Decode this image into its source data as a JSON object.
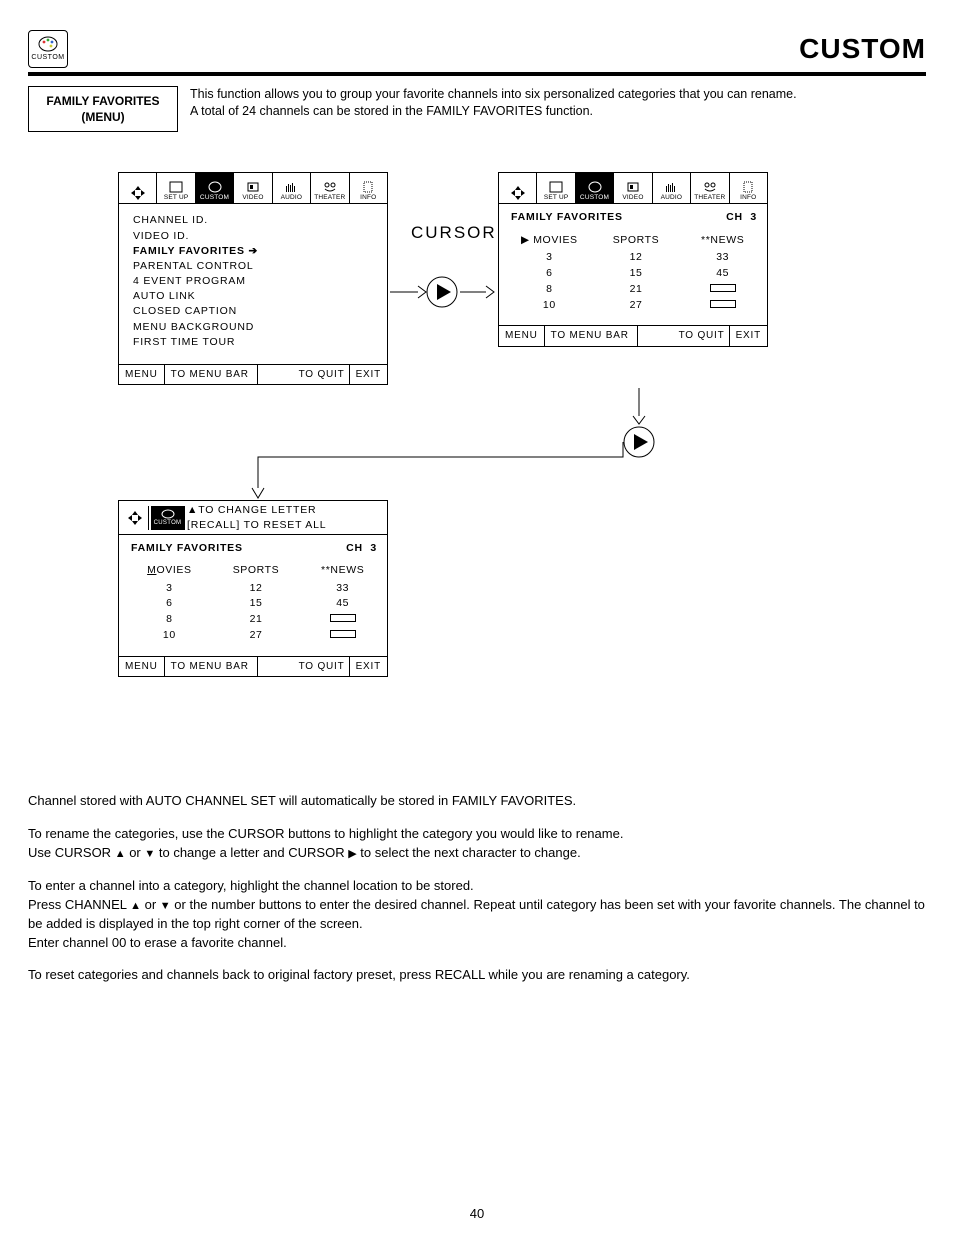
{
  "header": {
    "badge_label": "CUSTOM",
    "title": "CUSTOM"
  },
  "section": {
    "label_line1": "FAMILY FAVORITES",
    "label_line2": "(MENU)",
    "intro_line1": "This function allows you to group your favorite channels into six personalized categories that you can rename.",
    "intro_line2": "A total of 24 channels can be stored in the FAMILY FAVORITES function."
  },
  "iconbar": {
    "arrows": "",
    "items": [
      "SET UP",
      "CUSTOM",
      "VIDEO",
      "AUDIO",
      "THEATER",
      "INFO"
    ]
  },
  "menu_left": {
    "items": [
      "CHANNEL ID.",
      "VIDEO ID.",
      "FAMILY FAVORITES",
      "PARENTAL CONTROL",
      "4 EVENT PROGRAM",
      "AUTO LINK",
      "CLOSED CAPTION",
      "MENU BACKGROUND",
      "FIRST TIME TOUR"
    ],
    "selected_index": 2
  },
  "osd_footer": {
    "menu": "MENU",
    "bar": "TO MENU BAR",
    "quit": "TO QUIT",
    "exit": "EXIT"
  },
  "cursor_label": "CURSOR",
  "ff": {
    "title": "FAMILY FAVORITES",
    "ch_label": "CH",
    "ch_value": "3",
    "cols": [
      {
        "head": "MOVIES",
        "cells": [
          "3",
          "6",
          "8",
          "10"
        ],
        "selected": true,
        "prefix": "▶ "
      },
      {
        "head": "SPORTS",
        "cells": [
          "12",
          "15",
          "21",
          "27"
        ]
      },
      {
        "head": "**NEWS",
        "cells": [
          "33",
          "45",
          "[slot]",
          "[slot]"
        ]
      }
    ]
  },
  "edit_help": {
    "line1": "TO CHANGE LETTER",
    "line2": "[RECALL] TO RESET ALL"
  },
  "ff_edit": {
    "title": "FAMILY FAVORITES",
    "ch_label": "CH",
    "ch_value": "3",
    "cols": [
      {
        "head": "MOVIES",
        "cells": [
          "3",
          "6",
          "8",
          "10"
        ],
        "underline_first": true
      },
      {
        "head": "SPORTS",
        "cells": [
          "12",
          "15",
          "21",
          "27"
        ]
      },
      {
        "head": "**NEWS",
        "cells": [
          "33",
          "45",
          "[slot]",
          "[slot]"
        ]
      }
    ]
  },
  "body": {
    "p1": "Channel stored with AUTO CHANNEL SET will automatically be stored in FAMILY FAVORITES.",
    "p2a": "To rename the categories, use the CURSOR buttons to highlight the category you would like to rename.",
    "p2b_a": "Use CURSOR ",
    "p2b_b": " or ",
    "p2b_c": " to change a letter and CURSOR ",
    "p2b_d": " to select the next character to change.",
    "p3a": "To enter a channel into a category, highlight the channel location to be stored.",
    "p3b_a": "Press CHANNEL ",
    "p3b_b": " or ",
    "p3b_c": " or the number buttons to enter the desired channel.  Repeat until category has been set with your favorite channels.  The channel to be added is displayed in the top right corner of the screen.",
    "p3c": "Enter channel 00 to erase a favorite channel.",
    "p4": "To reset categories and channels back to original factory preset, press RECALL while you are renaming a category."
  },
  "page_number": "40"
}
